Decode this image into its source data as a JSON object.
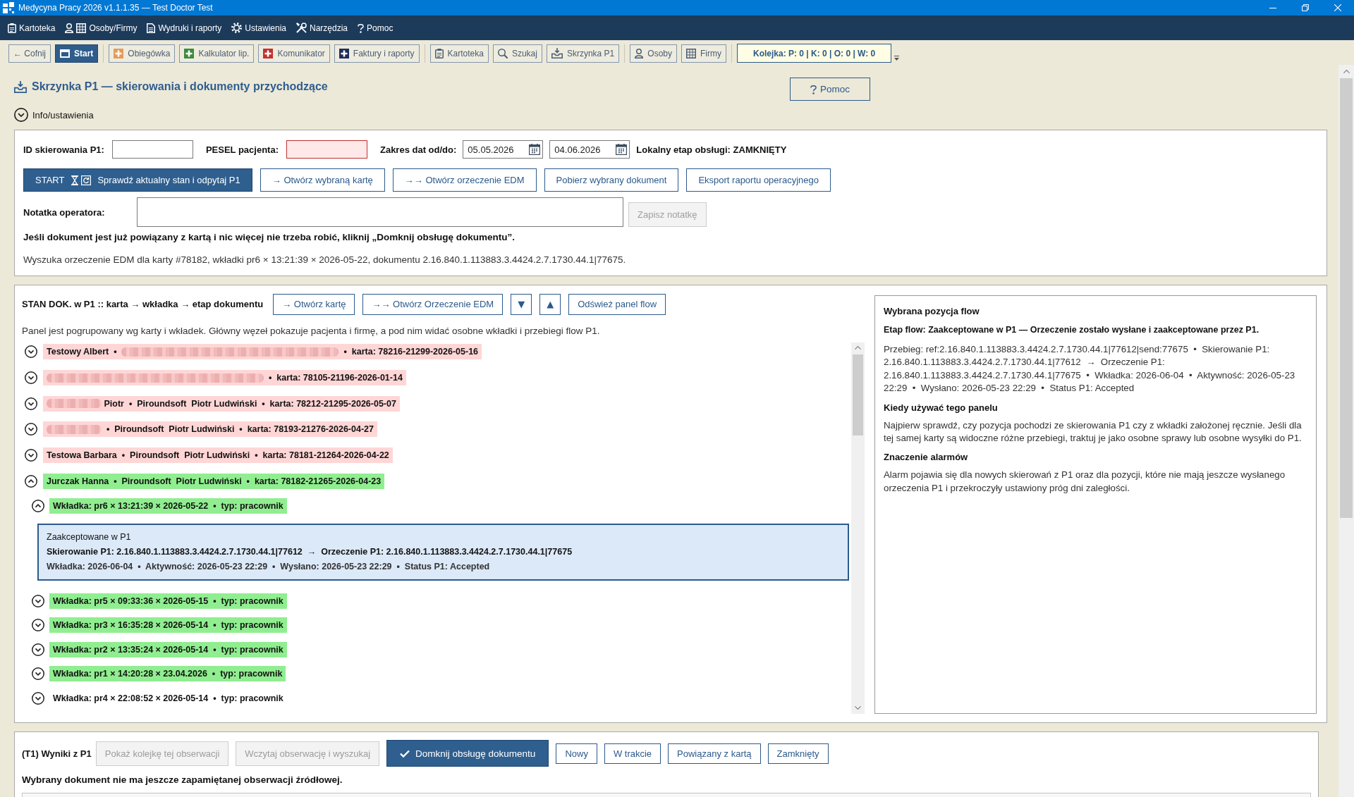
{
  "window": {
    "title": "Medycyna Pracy 2026 v1.1.1.35 — Test Doctor Test"
  },
  "menu": [
    "Kartoteka",
    "Osoby/Firmy",
    "Wydruki i raporty",
    "Ustawienia",
    "Narzędzia",
    "Pomoc"
  ],
  "toolbar": {
    "groups": [
      {
        "buttons": [
          {
            "label": "← Cofnij",
            "selected": false
          },
          {
            "label": "Start",
            "selected": true
          }
        ]
      },
      {
        "buttons": [
          {
            "label": "Obiegówka",
            "selected": false
          },
          {
            "label": "Kalkulator lip.",
            "selected": false
          },
          {
            "label": "Komunikator",
            "selected": false
          },
          {
            "label": "Faktury i raporty",
            "selected": false
          }
        ]
      },
      {
        "buttons": [
          {
            "label": "Kartoteka",
            "selected": false
          },
          {
            "label": "Szukaj",
            "selected": false
          },
          {
            "label": "Skrzynka P1",
            "selected": false
          }
        ]
      },
      {
        "buttons": [
          {
            "label": "Osoby",
            "selected": false
          },
          {
            "label": "Firmy",
            "selected": false
          }
        ]
      }
    ],
    "queue": "Kolejka: P: 0 | K: 0 | O: 0 | W: 0"
  },
  "header": {
    "title": "Skrzynka P1 — skierowania i dokumenty przychodzące",
    "help_button": "Pomoc"
  },
  "info_toggle": {
    "label": "Info/ustawienia",
    "expanded": false
  },
  "filters": {
    "id_field": {
      "label": "ID skierowania P1:",
      "invalid": false
    },
    "pesel_field": {
      "label": "PESEL pacjenta:",
      "invalid": true
    },
    "date_range": {
      "label": "Zakres dat od/do:",
      "from": "05.05.2026",
      "to": "04.06.2026"
    },
    "stage": "Lokalny etap obsługi: ZAMKNIĘTY",
    "actions": [
      {
        "kind": "primary",
        "prefix": "START",
        "label": "Sprawdź aktualny stan i odpytaj P1"
      },
      {
        "kind": "outline",
        "label": "→ Otwórz wybraną kartę"
      },
      {
        "kind": "outline",
        "label": "→→ Otwórz orzeczenie EDM"
      },
      {
        "kind": "outline",
        "label": "Pobierz wybrany dokument"
      },
      {
        "kind": "outline",
        "label": "Eksport raportu operacyjnego"
      }
    ],
    "note": {
      "label": "Notatka operatora:",
      "save_button": {
        "label": "Zapisz notatkę",
        "disabled": true
      }
    },
    "hint": "Jeśli dokument jest już powiązany z kartą i nic więcej nie trzeba robić, kliknij „Domknij obsługę dokumentu”.",
    "status": "Wyszuka orzeczenie EDM dla karty #78182, wkładki pr6 × 13:21:39 × 2026-05-22, dokumentu 2.16.840.1.113883.3.4424.2.7.1730.44.1|77675."
  },
  "flow_panel": {
    "title": "STAN DOK. w P1 :: karta → wkładka → etap dokumentu",
    "buttons": [
      {
        "kind": "text",
        "label": "→ Otwórz kartę"
      },
      {
        "kind": "text",
        "label": "→→ Otwórz Orzeczenie EDM"
      },
      {
        "kind": "arrow",
        "label": "▼"
      },
      {
        "kind": "arrow",
        "label": "▲"
      },
      {
        "kind": "text",
        "label": "Odśwież panel flow"
      }
    ],
    "description": "Panel jest pogrupowany wg karty i wkładek. Główny węzeł pokazuje pacjenta i firmę, a pod nim widać osobne wkładki i przebiegi flow P1.",
    "tree": [
      {
        "parts": [
          {
            "kind": "text",
            "text": "Testowy Albert  •  "
          },
          {
            "kind": "blurwide"
          },
          {
            "kind": "text",
            "text": "  •  karta: 78216-21299-2026-05-16"
          }
        ],
        "color": "#ffd6d6",
        "expanded": false
      },
      {
        "parts": [
          {
            "kind": "blurwide"
          },
          {
            "kind": "text",
            "text": "  •  karta: 78105-21196-2026-01-14"
          }
        ],
        "color": "#ffd6d6",
        "expanded": false
      },
      {
        "parts": [
          {
            "kind": "blur"
          },
          {
            "kind": "text",
            "text": " Piotr  •  Piroundsoft  Piotr Ludwiński  •  karta: 78212-21295-2026-05-07"
          }
        ],
        "color": "#ffd6d6",
        "expanded": false
      },
      {
        "parts": [
          {
            "kind": "blur"
          },
          {
            "kind": "text",
            "text": "  •  Piroundsoft  Piotr Ludwiński  •  karta: 78193-21276-2026-04-27"
          }
        ],
        "color": "#ffd6d6",
        "expanded": false
      },
      {
        "parts": [
          {
            "kind": "text",
            "text": "Testowa Barbara  •  Piroundsoft  Piotr Ludwiński  •  karta: 78181-21264-2026-04-22"
          }
        ],
        "color": "#ffd6d6",
        "expanded": false
      },
      {
        "parts": [
          {
            "kind": "text",
            "text": "Jurczak Hanna  •  Piroundsoft  Piotr Ludwiński  •  karta: 78182-21265-2026-04-23"
          }
        ],
        "color": "#90ee90",
        "expanded": true,
        "children": [
          {
            "label": "Wkładka: pr6 × 13:21:39 × 2026-05-22  •  typ: pracownik",
            "color": "#90ee90",
            "expanded": true,
            "children": [
              {
                "title": "Zaakceptowane w P1",
                "route": "Skierowanie P1: 2.16.840.1.113883.3.4424.2.7.1730.44.1|77612  →  Orzeczenie P1: 2.16.840.1.113883.3.4424.2.7.1730.44.1|77675",
                "meta": "Wkładka: 2026-06-04  •  Aktywność: 2026-05-23 22:29  •  Wysłano: 2026-05-23 22:29  •  Status P1: Accepted",
                "selected": true
              }
            ]
          },
          {
            "label": "Wkładka: pr5 × 09:33:36 × 2026-05-15  •  typ: pracownik",
            "color": "#90ee90",
            "expanded": false
          },
          {
            "label": "Wkładka: pr3 × 16:35:28 × 2026-05-14  •  typ: pracownik",
            "color": "#90ee90",
            "expanded": false
          },
          {
            "label": "Wkładka: pr2 × 13:35:24 × 2026-05-14  •  typ: pracownik",
            "color": "#90ee90",
            "expanded": false
          },
          {
            "label": "Wkładka: pr1 × 14:20:28 × 23.04.2026  •  typ: pracownik",
            "color": "#90ee90",
            "expanded": false
          },
          {
            "label": "Wkładka: pr4 × 22:08:52 × 2026-05-14  •  typ: pracownik",
            "expanded": false
          }
        ]
      }
    ],
    "details": {
      "title": "Wybrana pozycja flow",
      "stage": "Etap flow: Zaakceptowane w P1 — Orzeczenie zostało wysłane i zaakceptowane przez P1.",
      "trace": "Przebieg: ref:2.16.840.1.113883.3.4424.2.7.1730.44.1|77612|send:77675  •  Skierowanie P1: 2.16.840.1.113883.3.4424.2.7.1730.44.1|77612  →  Orzeczenie P1: 2.16.840.1.113883.3.4424.2.7.1730.44.1|77675  •  Wkładka: 2026-06-04  •  Aktywność: 2026-05-23 22:29  •  Wysłano: 2026-05-23 22:29  •  Status P1: Accepted",
      "sections": [
        {
          "heading": "Kiedy używać tego panelu",
          "text": "Najpierw sprawdź, czy pozycja pochodzi ze skierowania P1 czy z wkładki założonej ręcznie. Jeśli dla tej samej karty są widoczne różne przebiegi, traktuj je jako osobne sprawy lub osobne wysyłki do P1."
        },
        {
          "heading": "Znaczenie alarmów",
          "text": "Alarm pojawia się dla nowych skierowań z P1 oraz dla pozycji, które nie mają jeszcze wysłanego orzeczenia P1 i przekroczyły ustawiony próg dni zaległości."
        }
      ]
    }
  },
  "results": {
    "title": "(T1) Wyniki z P1",
    "buttons": [
      {
        "kind": "action",
        "label": "Pokaż kolejkę tej obserwacji",
        "disabled": true
      },
      {
        "kind": "action",
        "label": "Wczytaj obserwację i wyszukaj",
        "disabled": true
      },
      {
        "kind": "primary",
        "label": "Domknij obsługę dokumentu",
        "disabled": false
      },
      {
        "kind": "status",
        "label": "Nowy",
        "disabled": false
      },
      {
        "kind": "status",
        "label": "W trakcie",
        "disabled": false
      },
      {
        "kind": "status",
        "label": "Powiązany z kartą",
        "disabled": false
      },
      {
        "kind": "status",
        "label": "Zamknięty",
        "disabled": false
      }
    ],
    "message": "Wybrany dokument nie ma jeszcze zapamiętanej obserwacji źródłowej."
  }
}
